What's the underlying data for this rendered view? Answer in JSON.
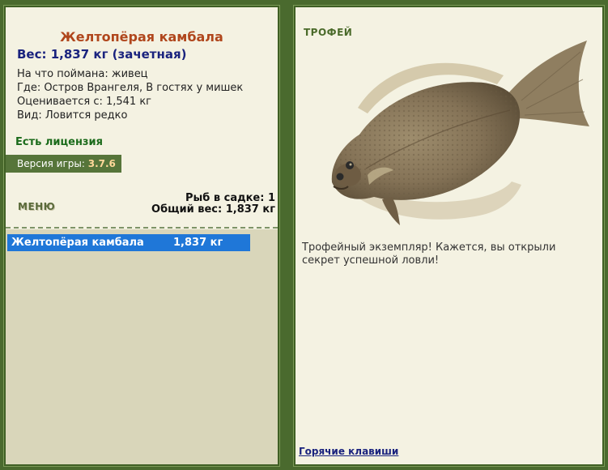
{
  "left": {
    "fish_title": "Желтопёрая камбала",
    "weight_line": "Вес: 1,837 кг (зачетная)",
    "info": [
      "На что поймана: живец",
      "Где: Остров Врангеля, В гостях у мишек",
      "Оценивается с: 1,541 кг",
      "Вид: Ловится редко"
    ],
    "license": "Есть лицензия",
    "version_label": "Версия игры:",
    "version_value": "3.7.6",
    "menu_label": "МЕНЮ",
    "fish_in_keepnet": "Рыб в садке: 1",
    "total_weight": "Общий вес: 1,837 кг",
    "catch_list": [
      {
        "name": "Желтопёрая камбала",
        "weight": "1,837 кг"
      }
    ]
  },
  "right": {
    "trophy_label": "ТРОФЕЙ",
    "description": "Трофейный экземпляр! Кажется, вы открыли секрет успешной ловли!",
    "hotkeys": "Горячие клавиши"
  },
  "colors": {
    "frame": "#4a6a2e",
    "panel": "#f4f2e2",
    "title": "#b0461c",
    "weight": "#1a237e",
    "license": "#1b6b1b",
    "selection": "#1f77d8"
  },
  "image": {
    "name": "flounder-fish-image"
  }
}
